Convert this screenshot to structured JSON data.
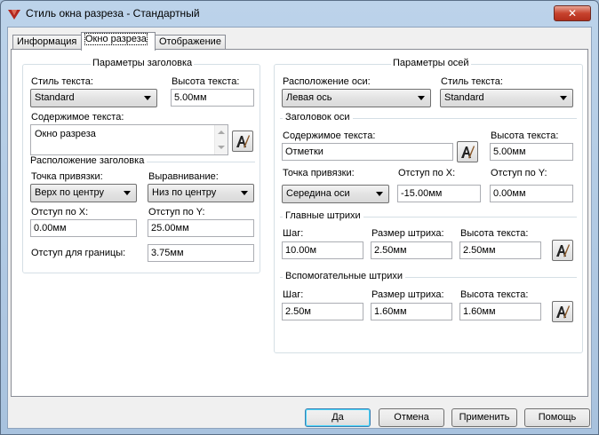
{
  "window": {
    "title": "Стиль окна разреза - Стандартный",
    "close_glyph": "✕"
  },
  "tabs": [
    {
      "label": "Информация"
    },
    {
      "label": "Окно разреза"
    },
    {
      "label": "Отображение"
    }
  ],
  "title_params": {
    "group_title": "Параметры заголовка",
    "text_style_label": "Стиль текста:",
    "text_style_value": "Standard",
    "text_height_label": "Высота текста:",
    "text_height_value": "5.00мм",
    "content_label": "Содержимое текста:",
    "content_value": "Окно разреза",
    "placement_section": "Расположение заголовка",
    "anchor_label": "Точка привязки:",
    "anchor_value": "Верх по центру",
    "align_label": "Выравнивание:",
    "align_value": "Низ по центру",
    "offset_x_label": "Отступ по X:",
    "offset_x_value": "0.00мм",
    "offset_y_label": "Отступ по Y:",
    "offset_y_value": "25.00мм",
    "border_offset_label": "Отступ для границы:",
    "border_offset_value": "3.75мм"
  },
  "axis_params": {
    "group_title": "Параметры осей",
    "axis_position_label": "Расположение оси:",
    "axis_position_value": "Левая ось",
    "text_style_label": "Стиль текста:",
    "text_style_value": "Standard",
    "axis_title_section": "Заголовок оси",
    "content_label": "Содержимое текста:",
    "content_value": "Отметки",
    "text_height_label": "Высота текста:",
    "text_height_value": "5.00мм",
    "anchor_label": "Точка привязки:",
    "anchor_value": "Середина оси",
    "offset_x_label": "Отступ по X:",
    "offset_x_value": "-15.00мм",
    "offset_y_label": "Отступ по Y:",
    "offset_y_value": "0.00мм",
    "major_section": "Главные штрихи",
    "major_step_label": "Шаг:",
    "major_step_value": "10.00м",
    "major_tick_size_label": "Размер штриха:",
    "major_tick_size_value": "2.50мм",
    "major_text_height_label": "Высота текста:",
    "major_text_height_value": "2.50мм",
    "minor_section": "Вспомогательные штрихи",
    "minor_step_label": "Шаг:",
    "minor_step_value": "2.50м",
    "minor_tick_size_label": "Размер штриха:",
    "minor_tick_size_value": "1.60мм",
    "minor_text_height_label": "Высота текста:",
    "minor_text_height_value": "1.60мм"
  },
  "buttons": {
    "ok": "Да",
    "cancel": "Отмена",
    "apply": "Применить",
    "help": "Помощь"
  }
}
